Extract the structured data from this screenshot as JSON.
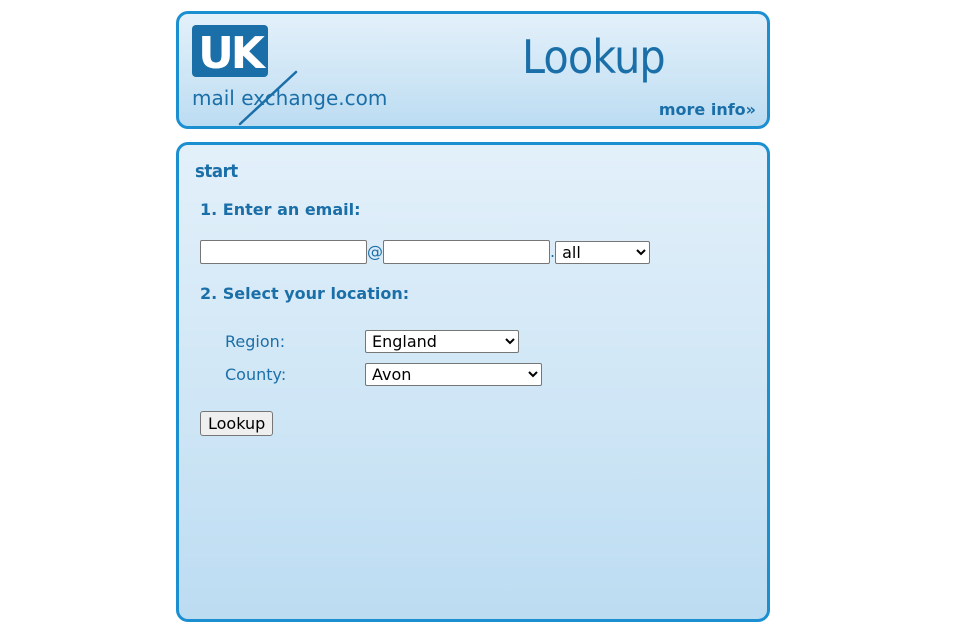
{
  "header": {
    "logo": {
      "uk": "UK",
      "brand_prefix": "mail e",
      "brand_x": "x",
      "brand_suffix": "change.com"
    },
    "title": "Lookup",
    "more_info": "more info»"
  },
  "main": {
    "section_title": "start",
    "step1_label": "1. Enter an email:",
    "email": {
      "user_value": "",
      "at_sign": "@",
      "domain_value": "",
      "dot": ".",
      "tld_selected": "all"
    },
    "step2_label": "2. Select your location:",
    "region": {
      "label": "Region:",
      "selected": "England"
    },
    "county": {
      "label": "County:",
      "selected": "Avon"
    },
    "lookup_button": "Lookup"
  },
  "colors": {
    "accent": "#1b6fa8",
    "border": "#1c8fd0",
    "panel_bg": "#d4e9f7"
  }
}
